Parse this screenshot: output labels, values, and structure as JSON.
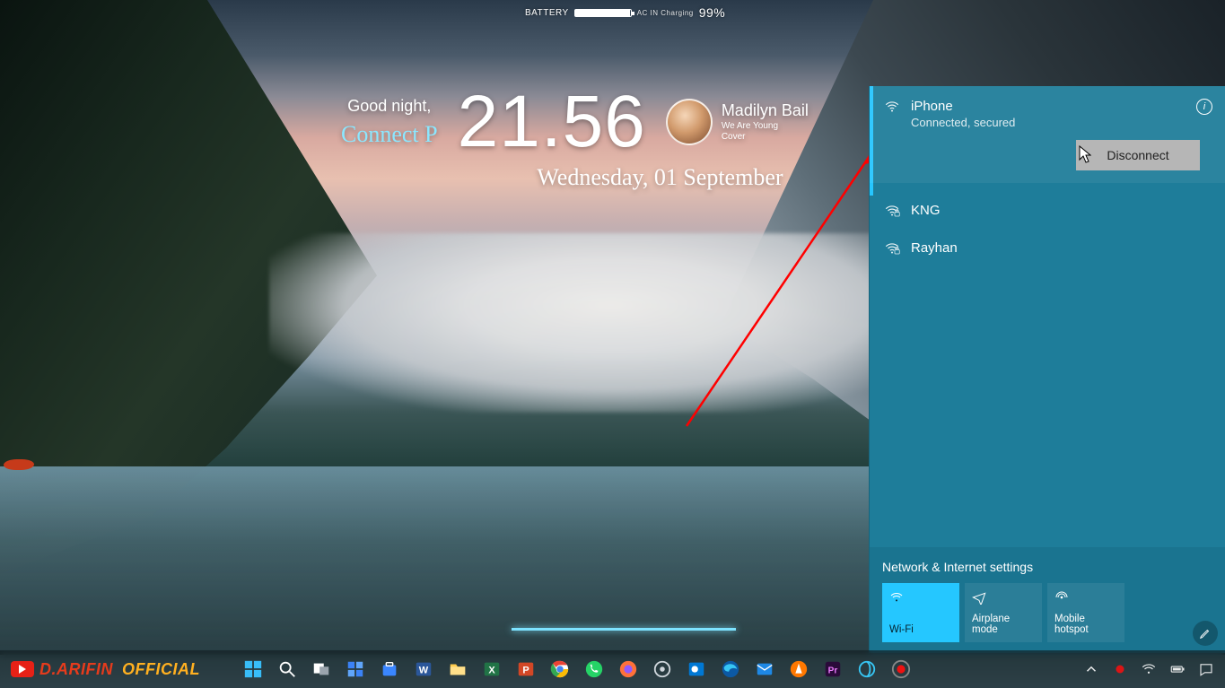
{
  "battery": {
    "label": "BATTERY",
    "sub": "AC IN   Charging",
    "percent": "99%",
    "fill": 99
  },
  "widget": {
    "greeting": "Good night,",
    "scriptName": "Connect P",
    "time": "21.56",
    "date": "Wednesday, 01 September",
    "artist": "Madilyn Bail",
    "trackLine1": "We Are Young",
    "trackLine2": "Cover"
  },
  "wifi": {
    "connected": {
      "name": "iPhone",
      "status": "Connected, secured"
    },
    "disconnect": "Disconnect",
    "others": [
      {
        "name": "KNG"
      },
      {
        "name": "Rayhan"
      }
    ],
    "settingsLink": "Network & Internet settings",
    "tiles": {
      "wifi": "Wi-Fi",
      "airplane": "Airplane mode",
      "hotspot": "Mobile hotspot"
    }
  },
  "taskbar": {
    "brand1": "D.ARIFIN",
    "brand2": "OFFICIAL",
    "icons": [
      "start",
      "search",
      "taskview",
      "widgets",
      "store",
      "word",
      "explorer",
      "excel",
      "powerpoint",
      "chrome",
      "whatsapp",
      "firefox",
      "settings",
      "outlook",
      "edge",
      "mail",
      "avast",
      "premiere",
      "pixlr",
      "record"
    ]
  }
}
